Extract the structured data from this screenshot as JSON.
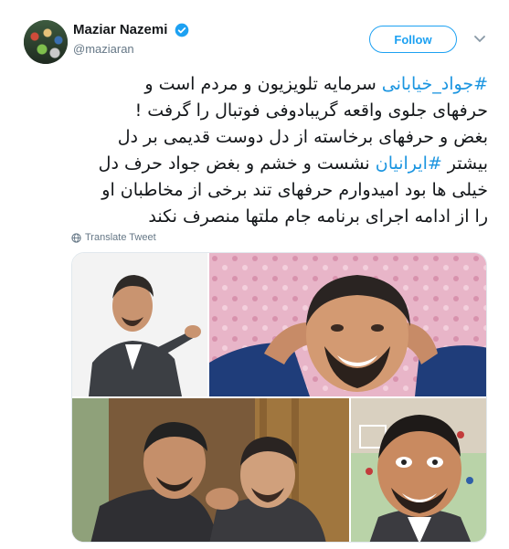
{
  "user": {
    "display_name": "Maziar Nazemi",
    "handle": "@maziaran",
    "verified": true,
    "avatar_icon": "avatar-crowd-image"
  },
  "actions": {
    "follow_label": "Follow",
    "menu_icon": "chevron-down-icon"
  },
  "tweet": {
    "lines": [
      {
        "hashtag": "#جواد_خیابانی",
        "text": " سرمایه تلویزیون و مردم است و"
      },
      {
        "hashtag": "",
        "text": "حرفهای جلوی واقعه گریبادوفی فوتبال را گرفت !"
      },
      {
        "hashtag": "",
        "text": "بغض و حرفهای برخاسته از دل دوست قدیمی بر دل"
      },
      {
        "prefix": "بیشتر ",
        "hashtag": "#ایرانیان",
        "text": " نشست و خشم و بغض جواد حرف دل"
      },
      {
        "hashtag": "",
        "text": "خیلی ها بود امیدوارم حرفهای تند برخی از مخاطبان او"
      },
      {
        "hashtag": "",
        "text": "را از ادامه اجرای برنامه جام ملتها منصرف نکند"
      }
    ],
    "hashtag_color": "#1b95e0"
  },
  "translate": {
    "label": "Translate Tweet",
    "icon": "globe-icon"
  },
  "media": {
    "photos": [
      {
        "name": "photo-speaker",
        "description_icon": "photo"
      },
      {
        "name": "photo-smiling",
        "description_icon": "photo"
      },
      {
        "name": "photo-two-men",
        "description_icon": "photo"
      },
      {
        "name": "photo-caricature",
        "description_icon": "photo"
      }
    ]
  },
  "colors": {
    "accent": "#1da1f2",
    "secondary_text": "#657786",
    "border": "#e1e8ed"
  }
}
